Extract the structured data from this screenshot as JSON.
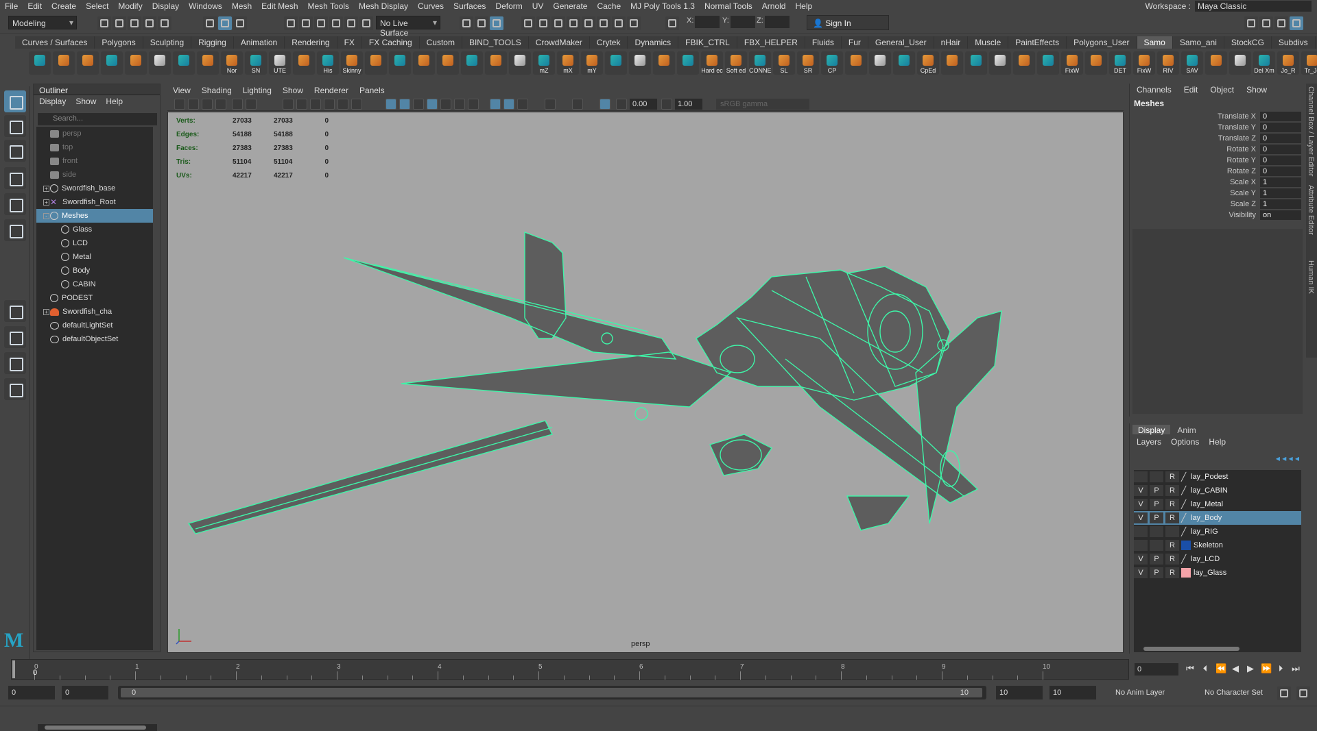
{
  "menubar": [
    "File",
    "Edit",
    "Create",
    "Select",
    "Modify",
    "Display",
    "Windows",
    "Mesh",
    "Edit Mesh",
    "Mesh Tools",
    "Mesh Display",
    "Curves",
    "Surfaces",
    "Deform",
    "UV",
    "Generate",
    "Cache",
    "MJ Poly Tools 1.3",
    "Normal Tools",
    "Arnold",
    "Help"
  ],
  "workspace": {
    "label": "Workspace :",
    "value": "Maya Classic"
  },
  "status": {
    "mode": "Modeling",
    "live_surface": "No Live Surface",
    "x_label": "X:",
    "y_label": "Y:",
    "z_label": "Z:",
    "sign_in": "Sign In"
  },
  "shelf_tabs": [
    "Curves / Surfaces",
    "Polygons",
    "Sculpting",
    "Rigging",
    "Animation",
    "Rendering",
    "FX",
    "FX Caching",
    "Custom",
    "BIND_TOOLS",
    "CrowdMaker",
    "Crytek",
    "Dynamics",
    "FBIK_CTRL",
    "FBX_HELPER",
    "Fluids",
    "Fur",
    "General_User",
    "nHair",
    "Muscle",
    "PaintEffects",
    "Polygons_User",
    "Samo",
    "Samo_ani",
    "StockCG",
    "Subdivs"
  ],
  "shelf_active": "Samo",
  "shelf_labels": [
    "",
    "",
    "",
    "",
    "",
    "",
    "",
    "",
    "Nor",
    "SN",
    "UTE",
    "",
    "His",
    "Skinny",
    "",
    "",
    "",
    "",
    "",
    "",
    "",
    "mZ",
    "mX",
    "mY",
    "",
    "",
    "",
    "",
    "Hard ec",
    "Soft ed",
    "CONNE",
    "SL",
    "SR",
    "CP",
    "",
    "",
    "",
    "CpEd",
    "",
    "",
    "",
    "",
    "",
    "FixW",
    "",
    "DET",
    "FixW",
    "RIV",
    "SAV",
    "",
    "",
    "Del Xm",
    "Jo_R",
    "Tr_Jo"
  ],
  "outliner": {
    "title": "Outliner",
    "menu": [
      "Display",
      "Show",
      "Help"
    ],
    "search_placeholder": "Search...",
    "items": [
      {
        "label": "persp",
        "icon": "camera-icon",
        "indent": 1,
        "dim": true
      },
      {
        "label": "top",
        "icon": "camera-icon",
        "indent": 1,
        "dim": true
      },
      {
        "label": "front",
        "icon": "camera-icon",
        "indent": 1,
        "dim": true
      },
      {
        "label": "side",
        "icon": "camera-icon",
        "indent": 1,
        "dim": true
      },
      {
        "label": "Swordfish_base",
        "icon": "mesh-icon",
        "indent": 1,
        "expand": "+"
      },
      {
        "label": "Swordfish_Root",
        "icon": "joint-icon",
        "indent": 1,
        "expand": "+"
      },
      {
        "label": "Meshes",
        "icon": "mesh-icon",
        "indent": 1,
        "expand": "-",
        "selected": true
      },
      {
        "label": "Glass",
        "icon": "mesh-icon",
        "indent": 2
      },
      {
        "label": "LCD",
        "icon": "mesh-icon",
        "indent": 2
      },
      {
        "label": "Metal",
        "icon": "mesh-icon",
        "indent": 2
      },
      {
        "label": "Body",
        "icon": "mesh-icon",
        "indent": 2
      },
      {
        "label": "CABIN",
        "icon": "mesh-icon",
        "indent": 2
      },
      {
        "label": "PODEST",
        "icon": "mesh-icon",
        "indent": 1
      },
      {
        "label": "Swordfish_cha",
        "icon": "character-icon",
        "indent": 1,
        "expand": "+"
      },
      {
        "label": "defaultLightSet",
        "icon": "set-icon",
        "indent": 1
      },
      {
        "label": "defaultObjectSet",
        "icon": "set-icon",
        "indent": 1
      }
    ]
  },
  "viewport": {
    "menu": [
      "View",
      "Shading",
      "Lighting",
      "Show",
      "Renderer",
      "Panels"
    ],
    "exposure": "0.00",
    "gamma": "1.00",
    "color_space": "sRGB gamma",
    "camera": "persp",
    "hud": [
      {
        "label": "Verts:",
        "a": "27033",
        "b": "27033",
        "c": "0"
      },
      {
        "label": "Edges:",
        "a": "54188",
        "b": "54188",
        "c": "0"
      },
      {
        "label": "Faces:",
        "a": "27383",
        "b": "27383",
        "c": "0"
      },
      {
        "label": "Tris:",
        "a": "51104",
        "b": "51104",
        "c": "0"
      },
      {
        "label": "UVs:",
        "a": "42217",
        "b": "42217",
        "c": "0"
      }
    ],
    "bg_color": "#a5a5a5",
    "wire_color": "#3ef5a8"
  },
  "channels": {
    "menu": [
      "Channels",
      "Edit",
      "Object",
      "Show"
    ],
    "object": "Meshes",
    "attrs": [
      {
        "label": "Translate X",
        "value": "0"
      },
      {
        "label": "Translate Y",
        "value": "0"
      },
      {
        "label": "Translate Z",
        "value": "0"
      },
      {
        "label": "Rotate X",
        "value": "0"
      },
      {
        "label": "Rotate Y",
        "value": "0"
      },
      {
        "label": "Rotate Z",
        "value": "0"
      },
      {
        "label": "Scale X",
        "value": "1"
      },
      {
        "label": "Scale Y",
        "value": "1"
      },
      {
        "label": "Scale Z",
        "value": "1"
      },
      {
        "label": "Visibility",
        "value": "on"
      }
    ]
  },
  "side_tabs": [
    "Channel Box / Layer Editor",
    "Attribute Editor",
    "Human IK"
  ],
  "layers": {
    "tabs": [
      "Display",
      "Anim"
    ],
    "menu": [
      "Layers",
      "Options",
      "Help"
    ],
    "items": [
      {
        "v": "",
        "p": "",
        "r": "R",
        "name": "lay_Podest",
        "color": ""
      },
      {
        "v": "V",
        "p": "P",
        "r": "R",
        "name": "lay_CABIN",
        "color": ""
      },
      {
        "v": "V",
        "p": "P",
        "r": "R",
        "name": "lay_Metal",
        "color": ""
      },
      {
        "v": "V",
        "p": "P",
        "r": "R",
        "name": "lay_Body",
        "color": "",
        "selected": true
      },
      {
        "v": "",
        "p": "",
        "r": "",
        "name": "lay_RIG",
        "color": ""
      },
      {
        "v": "",
        "p": "",
        "r": "R",
        "name": "Skeleton",
        "color": "#1a4fa8"
      },
      {
        "v": "V",
        "p": "P",
        "r": "R",
        "name": "lay_LCD",
        "color": ""
      },
      {
        "v": "V",
        "p": "P",
        "r": "R",
        "name": "lay_Glass",
        "color": "#f4a3a8"
      }
    ]
  },
  "timeline": {
    "ticks": [
      "0",
      "1",
      "2",
      "3",
      "4",
      "5",
      "6",
      "7",
      "8",
      "9",
      "10"
    ],
    "current": "0",
    "frame_box": "0"
  },
  "range": {
    "start": "0",
    "start2": "0",
    "slider_start": "0",
    "slider_end": "10",
    "end": "10",
    "end2": "10",
    "anim_layer": "No Anim Layer",
    "char_set": "No Character Set"
  }
}
